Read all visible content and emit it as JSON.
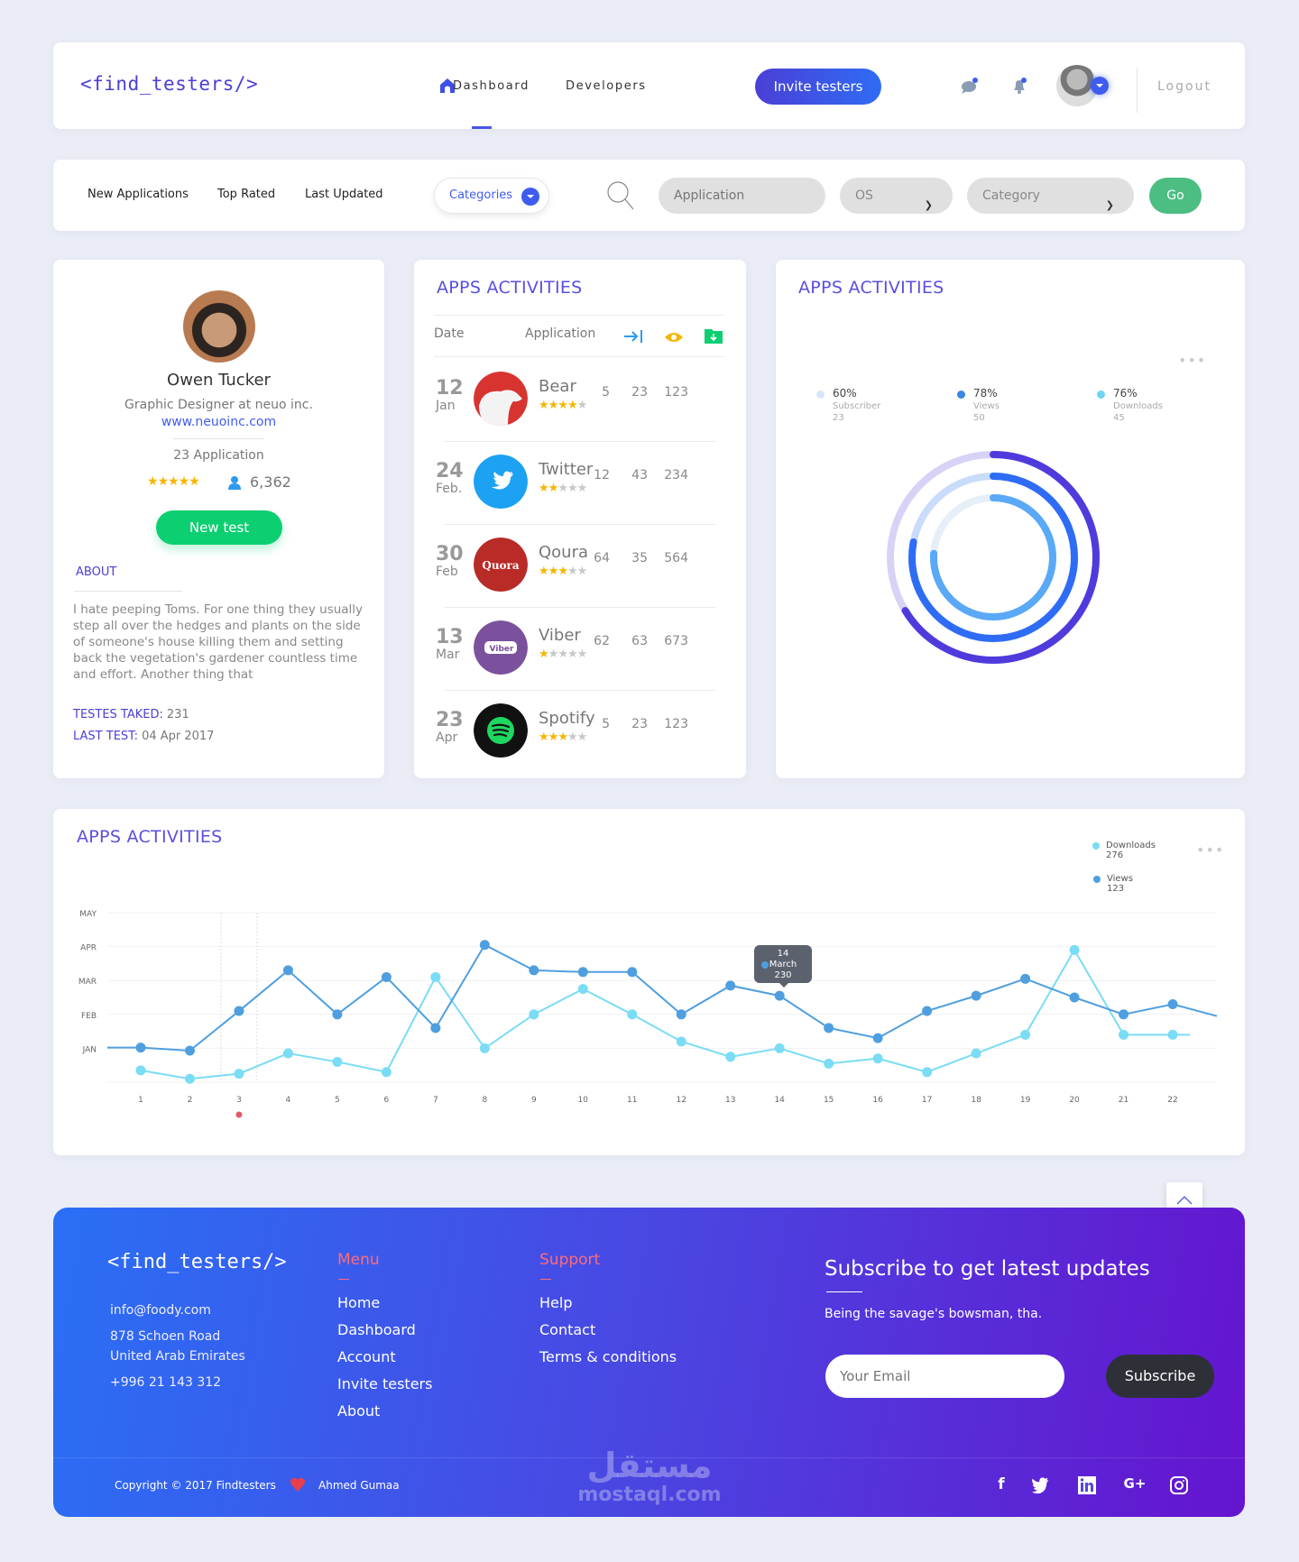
{
  "header": {
    "logo": "<find_testers/>",
    "nav": [
      "Dashboard",
      "Developers"
    ],
    "invite_label": "Invite testers",
    "logout_label": "Logout"
  },
  "filter": {
    "tabs": [
      "New Applications",
      "Top Rated",
      "Last Updated"
    ],
    "categories_label": "Categories",
    "application_placeholder": "Application",
    "os_value": "OS",
    "category_value": "Category",
    "go_label": "Go"
  },
  "profile": {
    "name": "Owen Tucker",
    "role": "Graphic Designer at neuo inc.",
    "url": "www.neuoinc.com",
    "applications": "23 Application",
    "rating": 5,
    "followers": "6,362",
    "new_test_label": "New test",
    "about_heading": "ABOUT",
    "about_text": "I hate peeping Toms. For one thing they usually step all over the hedges and plants on the side of someone's house killing them and setting back the vegetation's gardener countless time and effort. Another thing that",
    "tests_taken_label": "TESTES TAKED:",
    "tests_taken_value": "231",
    "last_test_label": "LAST TEST:",
    "last_test_value": "04 Apr 2017"
  },
  "apps_table": {
    "title": "APPS ACTIVITIES",
    "headers": [
      "Date",
      "Application"
    ],
    "header_icons": [
      "sign-in-icon",
      "eye-icon",
      "download-folder-icon"
    ],
    "rows": [
      {
        "day": "12",
        "month": "Jan",
        "name": "Bear",
        "rating": 4,
        "a": "5",
        "b": "23",
        "c": "123",
        "logo": "bear"
      },
      {
        "day": "24",
        "month": "Feb.",
        "name": "Twitter",
        "rating": 2,
        "a": "12",
        "b": "43",
        "c": "234",
        "logo": "twitter"
      },
      {
        "day": "30",
        "month": "Feb",
        "name": "Qoura",
        "rating": 3,
        "a": "64",
        "b": "35",
        "c": "564",
        "logo": "quora"
      },
      {
        "day": "13",
        "month": "Mar",
        "name": "Viber",
        "rating": 1,
        "a": "62",
        "b": "63",
        "c": "673",
        "logo": "viber"
      },
      {
        "day": "23",
        "month": "Apr",
        "name": "Spotify",
        "rating": 3,
        "a": "5",
        "b": "23",
        "c": "123",
        "logo": "spotify"
      }
    ],
    "logo_texts": {
      "quora": "Quora",
      "viber": "Viber"
    }
  },
  "radial": {
    "title": "APPS ACTIVITIES",
    "more": "•••",
    "legend": [
      {
        "pct": "60%",
        "label": "Subscriber",
        "value": "23",
        "color": "#d6e6f8"
      },
      {
        "pct": "78%",
        "label": "Views",
        "value": "50",
        "color": "#3a86e0"
      },
      {
        "pct": "76%",
        "label": "Downloads",
        "value": "45",
        "color": "#6fd3f5"
      }
    ]
  },
  "chart_data": {
    "type": "line",
    "title": "APPS ACTIVITIES",
    "x": [
      1,
      2,
      3,
      4,
      5,
      6,
      7,
      8,
      9,
      10,
      11,
      12,
      13,
      14,
      15,
      16,
      17,
      18,
      19,
      20,
      21,
      22
    ],
    "ytick_labels": [
      "JAN",
      "FEB",
      "MAR",
      "APR",
      "MAY"
    ],
    "ylim": [
      0,
      5
    ],
    "grid": true,
    "legend_position": "top-right",
    "series": [
      {
        "name": "Downloads",
        "total": "276",
        "color": "#7adcf5",
        "values": [
          0.35,
          0.1,
          0.25,
          0.85,
          0.6,
          0.3,
          3.1,
          1.0,
          2.0,
          2.75,
          2.0,
          1.2,
          0.75,
          1.0,
          0.55,
          0.7,
          0.3,
          0.85,
          1.4,
          3.9,
          1.4,
          1.4
        ],
        "tail": 1.4
      },
      {
        "name": "Views",
        "total": "123",
        "color": "#4f9fe0",
        "values": [
          1.02,
          0.93,
          2.1,
          3.3,
          2.0,
          3.1,
          1.6,
          4.05,
          3.3,
          3.25,
          3.25,
          2.0,
          2.85,
          2.55,
          1.6,
          1.3,
          2.1,
          2.55,
          3.05,
          2.5,
          2.0,
          2.3
        ],
        "lead": 1.02,
        "tail": 1.95
      }
    ],
    "tooltip": {
      "day": "14",
      "month": "March",
      "value": "230"
    },
    "highlighted_x": 3,
    "more": "•••"
  },
  "footer": {
    "logo": "<find_testers/>",
    "email": "info@foody.com",
    "address1": "878 Schoen Road",
    "address2": "United Arab Emirates",
    "phone": "+996 21 143 312",
    "menu_heading": "Menu",
    "menu": [
      "Home",
      "Dashboard",
      "Account",
      "Invite testers",
      "About"
    ],
    "support_heading": "Support",
    "support": [
      "Help",
      "Contact",
      "Terms & conditions"
    ],
    "subscribe_title": "Subscribe to get latest updates",
    "subscribe_desc": "Being the savage's bowsman, tha.",
    "email_placeholder": "Your Email",
    "subscribe_label": "Subscribe",
    "copyright": "Copyright © 2017 Findtesters",
    "author": "Ahmed Gumaa",
    "social": [
      "f",
      "t",
      "in",
      "G+",
      "ig"
    ]
  },
  "watermark": "مستقل\nmostaql.com"
}
